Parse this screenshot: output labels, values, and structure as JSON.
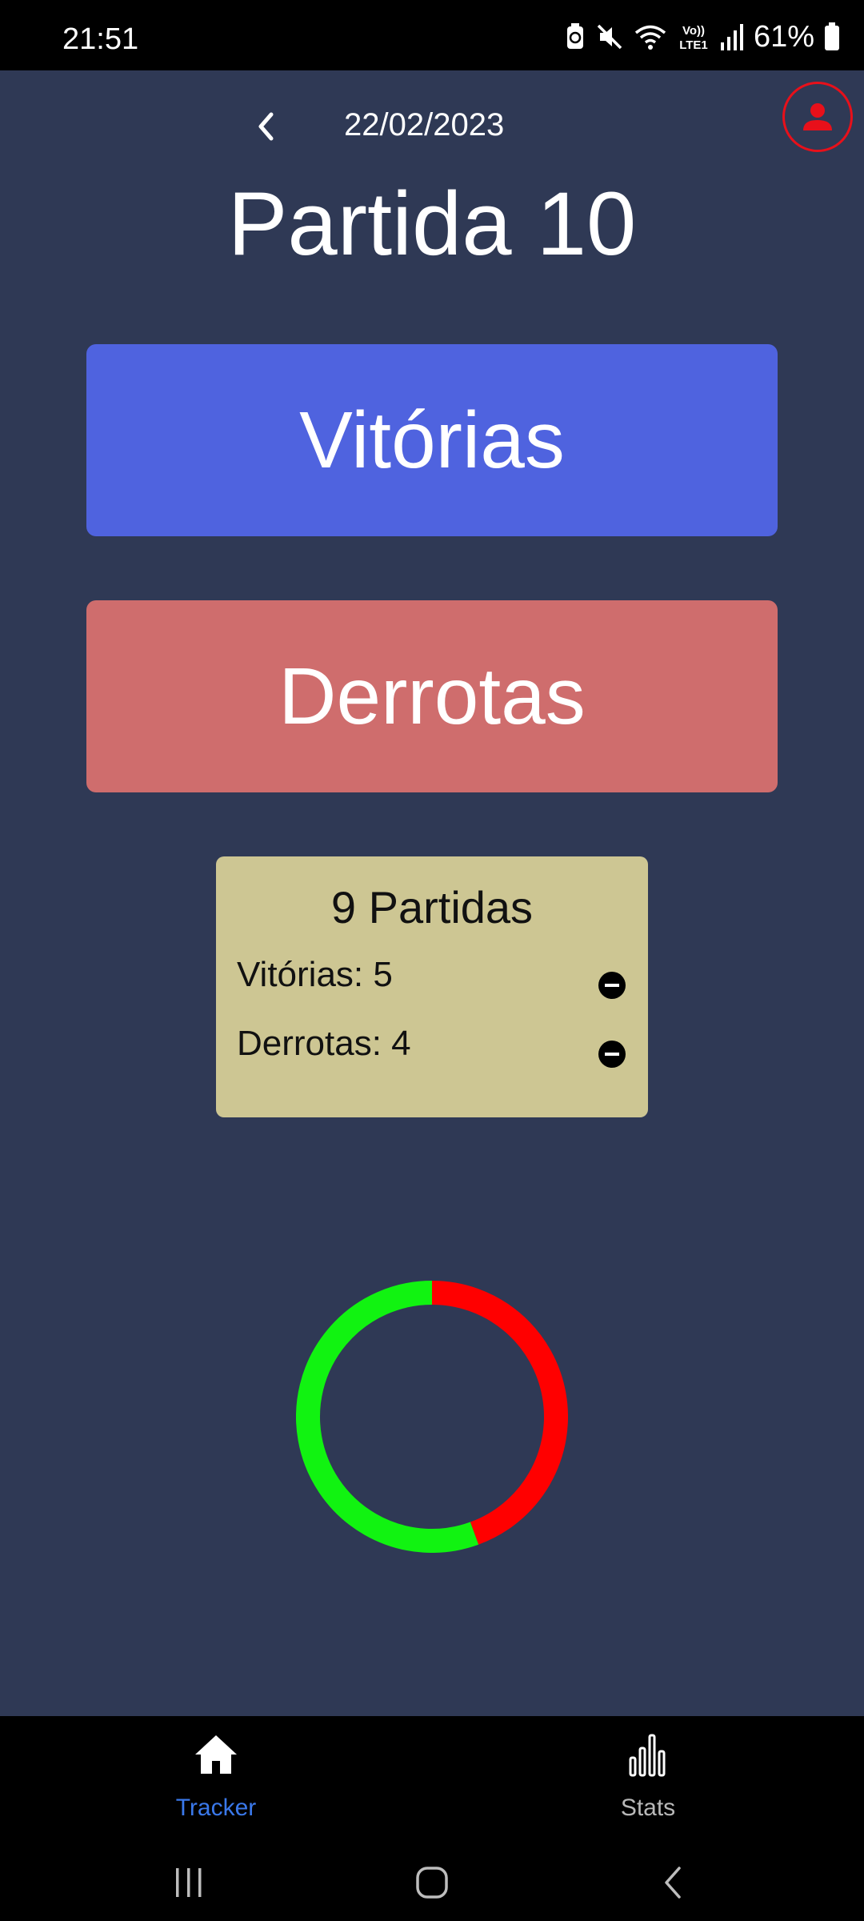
{
  "status_bar": {
    "time": "21:51",
    "battery_percent": "61%",
    "icons": [
      "battery-saver-icon",
      "mute-icon",
      "wifi-icon",
      "volte-icon",
      "signal-icon",
      "battery-icon"
    ]
  },
  "header": {
    "date": "22/02/2023",
    "title": "Partida 10"
  },
  "buttons": {
    "wins_label": "Vitórias",
    "losses_label": "Derrotas"
  },
  "summary": {
    "title": "9 Partidas",
    "wins_label": "Vitórias: 5",
    "losses_label": "Derrotas: 4"
  },
  "chart_data": {
    "type": "pie",
    "categories": [
      "Vitórias",
      "Derrotas"
    ],
    "values": [
      5,
      4
    ],
    "colors": [
      "#11f311",
      "#ff0000"
    ]
  },
  "bottom_nav": {
    "tabs": [
      {
        "label": "Tracker",
        "icon": "home-icon",
        "active": true
      },
      {
        "label": "Stats",
        "icon": "bar-chart-icon",
        "active": false
      }
    ]
  },
  "colors": {
    "background": "#2f3955",
    "wins_button": "#4f63df",
    "losses_button": "#cf6d6d",
    "summary_card": "#cdc693",
    "active_tab": "#3a78ea",
    "profile_accent": "#e8101a"
  }
}
